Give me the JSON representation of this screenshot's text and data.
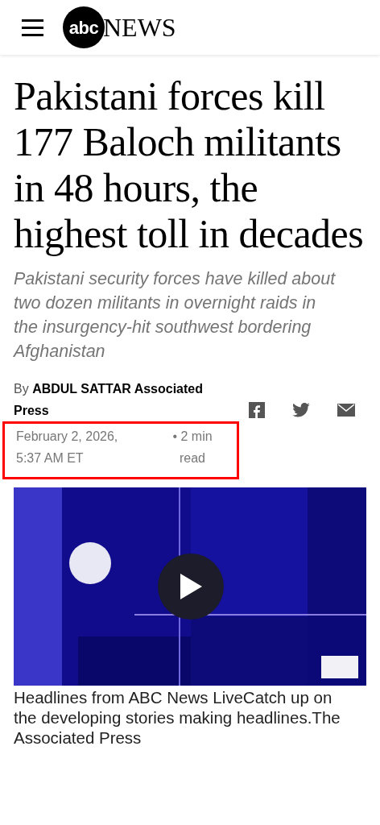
{
  "header": {
    "logo_mark": "abc",
    "logo_word": "NEWS"
  },
  "article": {
    "headline": "Pakistani forces kill 177 Baloch militants in 48 hours, the highest toll in decades",
    "subhead": "Pakistani security forces have killed about two dozen militants in overnight raids in the insurgency-hit southwest bordering Afghanistan",
    "byline_prefix": "By",
    "author": "ABDUL SATTAR Associated Press",
    "date": "February 2, 2026, 5:37 AM ET",
    "read_time": "• 2 min read",
    "highlighted": true
  },
  "video": {
    "kind": "picture",
    "caption": "Headlines from ABC News LiveCatch up on the developing stories making headlines.The Associated Press"
  }
}
